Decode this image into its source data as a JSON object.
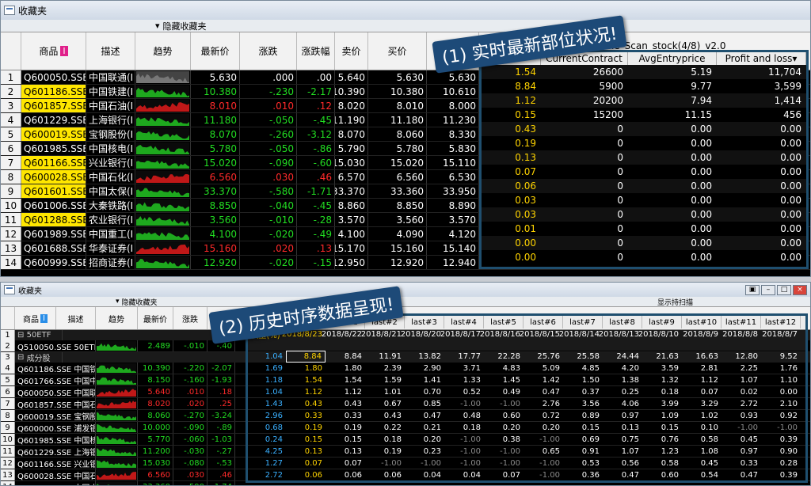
{
  "top": {
    "window_title": "收藏夹",
    "hidden_label": "隐藏收藏夹",
    "scan_title": "mbine_Scan_stock(4/8)_v2.0",
    "headers": [
      "商品",
      "描述",
      "趋势",
      "最新价",
      "涨跌",
      "涨跌幅",
      "卖价",
      "买价"
    ],
    "badge": "I",
    "rows": [
      {
        "i": "1",
        "code": "Q600050.SSE",
        "name": "中国联通(I",
        "last": "5.630",
        "chg": ".000",
        "pct": ".00",
        "ask": "5.640",
        "bid": "5.630",
        "extra": "5.630",
        "cls": "w",
        "hl": false,
        "spark": "gray"
      },
      {
        "i": "2",
        "code": "Q601186.SSE",
        "name": "中国铁建(I",
        "last": "10.380",
        "chg": "-.230",
        "pct": "-2.17",
        "ask": "10.390",
        "bid": "10.380",
        "extra": "10.610",
        "cls": "g",
        "hl": true,
        "spark": "green"
      },
      {
        "i": "3",
        "code": "Q601857.SSE",
        "name": "中国石油(I",
        "last": "8.010",
        "chg": ".010",
        "pct": ".12",
        "ask": "8.020",
        "bid": "8.010",
        "extra": "8.000",
        "cls": "r",
        "hl": true,
        "spark": "red"
      },
      {
        "i": "4",
        "code": "Q601229.SSE",
        "name": "上海银行(I",
        "last": "11.180",
        "chg": "-.050",
        "pct": "-.45",
        "ask": "11.190",
        "bid": "11.180",
        "extra": "11.230",
        "cls": "g",
        "hl": false,
        "spark": "green"
      },
      {
        "i": "5",
        "code": "Q600019.SSE",
        "name": "宝钢股份(I",
        "last": "8.070",
        "chg": "-.260",
        "pct": "-3.12",
        "ask": "8.070",
        "bid": "8.060",
        "extra": "8.330",
        "cls": "g",
        "hl": true,
        "spark": "green"
      },
      {
        "i": "6",
        "code": "Q601985.SSE",
        "name": "中国核电(I",
        "last": "5.780",
        "chg": "-.050",
        "pct": "-.86",
        "ask": "5.790",
        "bid": "5.780",
        "extra": "5.830",
        "cls": "g",
        "hl": false,
        "spark": "green"
      },
      {
        "i": "7",
        "code": "Q601166.SSE",
        "name": "兴业银行(I",
        "last": "15.020",
        "chg": "-.090",
        "pct": "-.60",
        "ask": "15.030",
        "bid": "15.020",
        "extra": "15.110",
        "cls": "g",
        "hl": true,
        "spark": "green"
      },
      {
        "i": "8",
        "code": "Q600028.SSE",
        "name": "中国石化(I",
        "last": "6.560",
        "chg": ".030",
        "pct": ".46",
        "ask": "6.570",
        "bid": "6.560",
        "extra": "6.530",
        "cls": "r",
        "hl": true,
        "spark": "red"
      },
      {
        "i": "9",
        "code": "Q601601.SSE",
        "name": "中国太保(I",
        "last": "33.370",
        "chg": "-.580",
        "pct": "-1.71",
        "ask": "33.370",
        "bid": "33.360",
        "extra": "33.950",
        "cls": "g",
        "hl": true,
        "spark": "green"
      },
      {
        "i": "10",
        "code": "Q601006.SSE",
        "name": "大秦铁路(I",
        "last": "8.850",
        "chg": "-.040",
        "pct": "-.45",
        "ask": "8.860",
        "bid": "8.850",
        "extra": "8.890",
        "cls": "g",
        "hl": false,
        "spark": "green"
      },
      {
        "i": "11",
        "code": "Q601288.SSE",
        "name": "农业银行(I",
        "last": "3.560",
        "chg": "-.010",
        "pct": "-.28",
        "ask": "3.570",
        "bid": "3.560",
        "extra": "3.570",
        "cls": "g",
        "hl": true,
        "spark": "green"
      },
      {
        "i": "12",
        "code": "Q601989.SSE",
        "name": "中国重工(I",
        "last": "4.100",
        "chg": "-.020",
        "pct": "-.49",
        "ask": "4.100",
        "bid": "4.090",
        "extra": "4.120",
        "cls": "g",
        "hl": false,
        "spark": "green"
      },
      {
        "i": "13",
        "code": "Q601688.SSE",
        "name": "华泰证券(I",
        "last": "15.160",
        "chg": ".020",
        "pct": ".13",
        "ask": "15.170",
        "bid": "15.160",
        "extra": "15.140",
        "cls": "r",
        "hl": false,
        "spark": "red"
      },
      {
        "i": "14",
        "code": "Q600999.SSE",
        "name": "招商证券(I",
        "last": "12.920",
        "chg": "-.020",
        "pct": "-.15",
        "ask": "12.950",
        "bid": "12.920",
        "extra": "12.940",
        "cls": "g",
        "hl": false,
        "spark": "green"
      }
    ]
  },
  "positions": {
    "headers": [
      "",
      "CurrentContract",
      "AvgEntryprice",
      "Profit and loss▾"
    ],
    "rows": [
      [
        "1.54",
        "26600",
        "5.19",
        "11,704"
      ],
      [
        "8.84",
        "5900",
        "9.77",
        "3,599"
      ],
      [
        "1.12",
        "20200",
        "7.94",
        "1,414"
      ],
      [
        "0.15",
        "15200",
        "11.15",
        "456"
      ],
      [
        "0.43",
        "0",
        "0.00",
        "0.00"
      ],
      [
        "0.19",
        "0",
        "0.00",
        "0.00"
      ],
      [
        "0.13",
        "0",
        "0.00",
        "0.00"
      ],
      [
        "0.07",
        "0",
        "0.00",
        "0.00"
      ],
      [
        "0.06",
        "0",
        "0.00",
        "0.00"
      ],
      [
        "0.03",
        "0",
        "0.00",
        "0.00"
      ],
      [
        "0.03",
        "0",
        "0.00",
        "0.00"
      ],
      [
        "0.01",
        "0",
        "0.00",
        "0.00"
      ],
      [
        "0.00",
        "0",
        "0.00",
        "0.00"
      ],
      [
        "0.00",
        "0",
        "0.00",
        "0.00"
      ]
    ]
  },
  "callouts": {
    "one": "(1) 实时最新部位状况!",
    "two": "(2) 历史时序数据呈现!"
  },
  "bottom": {
    "window_title": "收藏夹",
    "hidden_label": "隐藏收藏夹",
    "show_label": "显示持扫描",
    "headers": [
      "商品",
      "描述",
      "趋势",
      "最新价",
      "涨跌"
    ],
    "badge": "I",
    "group1": "50ETF",
    "group2": "成分股",
    "etf_row": {
      "i": "2",
      "code": "Q510050.SSE 50ETF(期",
      "last": "2.489",
      "chg": "-.010",
      "pct": "-.40"
    },
    "rows": [
      {
        "i": "4",
        "code": "Q601186.SSE 中国铁建(",
        "last": "10.390",
        "chg": "-.220",
        "pct": "-2.07",
        "cls": "g"
      },
      {
        "i": "5",
        "code": "Q601766.SSE 中国中车(",
        "last": "8.150",
        "chg": "-.160",
        "pct": "-1.93",
        "cls": "g"
      },
      {
        "i": "6",
        "code": "Q600050.SSE 中国联通(",
        "last": "5.640",
        "chg": ".010",
        "pct": ".18",
        "cls": "r"
      },
      {
        "i": "7",
        "code": "Q601857.SSE 中国石油(",
        "last": "8.020",
        "chg": ".020",
        "pct": ".25",
        "cls": "r"
      },
      {
        "i": "8",
        "code": "Q600019.SSE 宝钢股份(",
        "last": "8.060",
        "chg": "-.270",
        "pct": "-3.24",
        "cls": "g"
      },
      {
        "i": "9",
        "code": "Q600000.SSE 浦发银行(",
        "last": "10.000",
        "chg": "-.090",
        "pct": "-.89",
        "cls": "g"
      },
      {
        "i": "10",
        "code": "Q601985.SSE 中国核电(",
        "last": "5.770",
        "chg": "-.060",
        "pct": "-1.03",
        "cls": "g"
      },
      {
        "i": "11",
        "code": "Q601229.SSE 上海银行(",
        "last": "11.200",
        "chg": "-.030",
        "pct": "-.27",
        "cls": "g"
      },
      {
        "i": "12",
        "code": "Q601166.SSE 兴业银行(",
        "last": "15.030",
        "chg": "-.080",
        "pct": "-.53",
        "cls": "g"
      },
      {
        "i": "13",
        "code": "Q600028.SSE 中国石化(",
        "last": "6.560",
        "chg": ".030",
        "pct": ".46",
        "cls": "r"
      },
      {
        "i": "14",
        "code": "Q601601.SSE 中国太保(",
        "last": "33.360",
        "chg": "-.590",
        "pct": "-1.74",
        "cls": "g"
      }
    ]
  },
  "history": {
    "headers": [
      "Today▾",
      "last#1",
      "last#2",
      "last#3",
      "last#4",
      "last#5",
      "last#6",
      "last#7",
      "last#8",
      "last#9",
      "last#10",
      "last#11",
      "last#12"
    ],
    "weight_label": "权重(%)",
    "dates": [
      "2018/8/23",
      "2018/8/22",
      "2018/8/21",
      "2018/8/20",
      "2018/8/17",
      "2018/8/16",
      "2018/8/15",
      "2018/8/14",
      "2018/8/13",
      "2018/8/10",
      "2018/8/9",
      "2018/8/8",
      "2018/8/7"
    ],
    "rows": [
      {
        "w": "1.04",
        "v": [
          "8.84",
          "8.84",
          "11.91",
          "13.82",
          "17.77",
          "22.28",
          "25.76",
          "25.58",
          "24.44",
          "21.63",
          "16.63",
          "12.80",
          "9.52"
        ]
      },
      {
        "w": "1.69",
        "v": [
          "1.80",
          "1.80",
          "2.39",
          "2.90",
          "3.71",
          "4.83",
          "5.09",
          "4.85",
          "4.20",
          "3.59",
          "2.81",
          "2.25",
          "1.76"
        ]
      },
      {
        "w": "1.18",
        "v": [
          "1.54",
          "1.54",
          "1.59",
          "1.41",
          "1.33",
          "1.45",
          "1.42",
          "1.50",
          "1.38",
          "1.32",
          "1.12",
          "1.07",
          "1.10"
        ]
      },
      {
        "w": "1.04",
        "v": [
          "1.12",
          "1.12",
          "1.01",
          "0.70",
          "0.52",
          "0.49",
          "0.47",
          "0.37",
          "0.25",
          "0.18",
          "0.07",
          "0.02",
          "0.00"
        ]
      },
      {
        "w": "1.43",
        "v": [
          "0.43",
          "0.43",
          "0.67",
          "0.85",
          "-1.00",
          "-1.00",
          "2.76",
          "3.56",
          "4.06",
          "3.99",
          "3.29",
          "2.72",
          "2.10"
        ]
      },
      {
        "w": "2.96",
        "v": [
          "0.33",
          "0.33",
          "0.43",
          "0.47",
          "0.48",
          "0.60",
          "0.72",
          "0.89",
          "0.97",
          "1.09",
          "1.02",
          "0.93",
          "0.92"
        ]
      },
      {
        "w": "0.68",
        "v": [
          "0.19",
          "0.19",
          "0.22",
          "0.21",
          "0.18",
          "0.20",
          "0.20",
          "0.15",
          "0.13",
          "0.15",
          "0.10",
          "-1.00",
          "-1.00"
        ]
      },
      {
        "w": "0.24",
        "v": [
          "0.15",
          "0.15",
          "0.18",
          "0.20",
          "-1.00",
          "0.38",
          "-1.00",
          "0.69",
          "0.75",
          "0.76",
          "0.58",
          "0.45",
          "0.39"
        ]
      },
      {
        "w": "4.25",
        "v": [
          "0.13",
          "0.13",
          "0.19",
          "0.23",
          "-1.00",
          "-1.00",
          "0.65",
          "0.91",
          "1.07",
          "1.23",
          "1.08",
          "0.97",
          "0.90"
        ]
      },
      {
        "w": "1.27",
        "v": [
          "0.07",
          "0.07",
          "-1.00",
          "-1.00",
          "-1.00",
          "-1.00",
          "-1.00",
          "0.53",
          "0.56",
          "0.58",
          "0.45",
          "0.33",
          "0.28"
        ]
      },
      {
        "w": "2.72",
        "v": [
          "0.06",
          "0.06",
          "0.06",
          "0.04",
          "0.04",
          "0.07",
          "-1.00",
          "0.36",
          "0.47",
          "0.60",
          "0.54",
          "0.47",
          "0.39"
        ]
      }
    ]
  },
  "colors": {
    "up": "#ff2a2a",
    "down": "#22dd22",
    "flat": "#ffffff",
    "highlight": "#ffe600",
    "accent_border": "#1f4f6f",
    "callout": "#1d4a78"
  }
}
